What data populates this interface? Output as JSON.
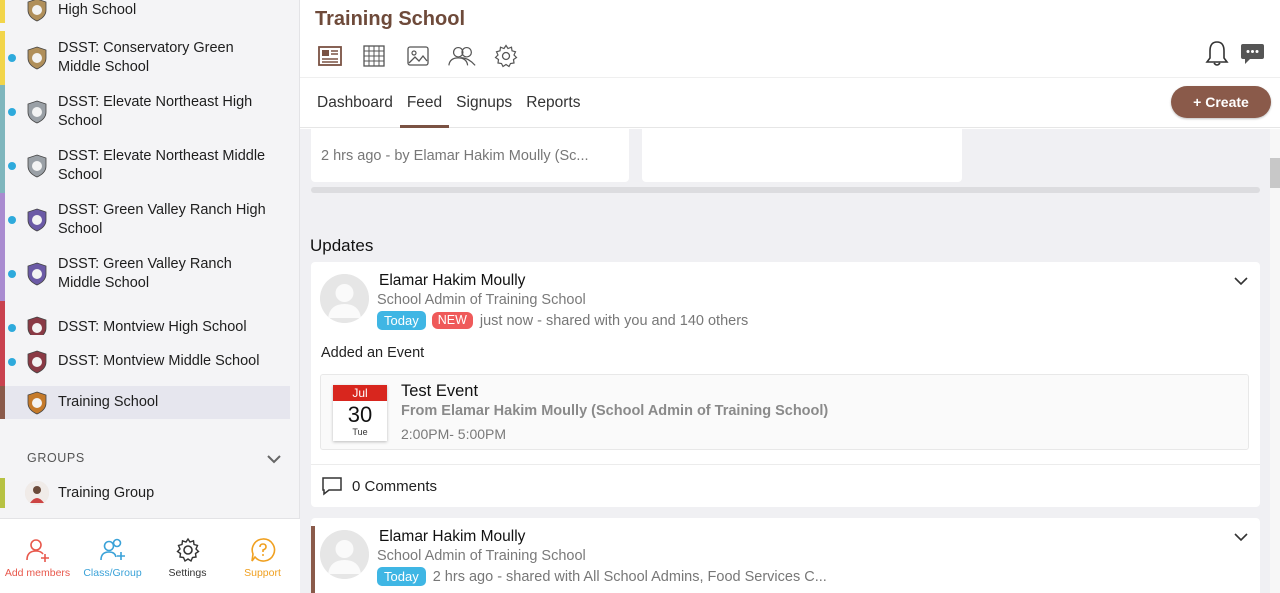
{
  "sidebar": {
    "schools": [
      {
        "name": "High School",
        "bar_color": "#f2d54a",
        "dot": false,
        "logo_color": "#b08f5a"
      },
      {
        "name": "DSST: Conservatory Green Middle School",
        "bar_color": "#f2d54a",
        "dot": true,
        "logo_color": "#b08f5a"
      },
      {
        "name": "DSST: Elevate Northeast High School",
        "bar_color": "#7fb6bd",
        "dot": true,
        "logo_color": "#9aa0a6"
      },
      {
        "name": "DSST: Elevate Northeast Middle School",
        "bar_color": "#7fb6bd",
        "dot": true,
        "logo_color": "#9aa0a6"
      },
      {
        "name": "DSST: Green Valley Ranch High School",
        "bar_color": "#a98bd0",
        "dot": true,
        "logo_color": "#6b5aa6"
      },
      {
        "name": "DSST: Green Valley Ranch Middle School",
        "bar_color": "#a98bd0",
        "dot": true,
        "logo_color": "#6b5aa6"
      },
      {
        "name": "DSST: Montview High School",
        "bar_color": "#c9424f",
        "dot": true,
        "logo_color": "#8a3a45"
      },
      {
        "name": "DSST: Montview Middle School",
        "bar_color": "#c9424f",
        "dot": true,
        "logo_color": "#8a3a45"
      },
      {
        "name": "Training School",
        "bar_color": "#8a5a4a",
        "dot": false,
        "logo_color": "#c57a2a",
        "active": true
      }
    ],
    "groups_label": "GROUPS",
    "group": {
      "name": "Training Group",
      "bar_color": "#b7c243"
    },
    "bottom": [
      {
        "label": "Add members",
        "color": "#e8584c",
        "icon": "add-member-icon"
      },
      {
        "label": "Class/Group",
        "color": "#3aa2d8",
        "icon": "class-group-icon"
      },
      {
        "label": "Settings",
        "color": "#333333",
        "icon": "gear-icon"
      },
      {
        "label": "Support",
        "color": "#f0a020",
        "icon": "support-icon"
      }
    ]
  },
  "header": {
    "title": "Training School",
    "tabs": [
      "Dashboard",
      "Feed",
      "Signups",
      "Reports"
    ],
    "active_tab": "Feed",
    "create_label": "+ Create"
  },
  "feed": {
    "prev_meta": "2 hrs ago - by Elamar Hakim Moully (Sc...",
    "updates_title": "Updates",
    "post1": {
      "author": "Elamar Hakim Moully",
      "role": "School Admin of Training School",
      "badge_today": "Today",
      "badge_new": "NEW",
      "meta": "just now - shared with you and 140 others",
      "action": "Added an Event",
      "event": {
        "month": "Jul",
        "day": "30",
        "dow": "Tue",
        "title": "Test Event",
        "from": "From Elamar Hakim Moully (School Admin of Training School)",
        "time": "2:00PM- 5:00PM"
      },
      "comments": "0 Comments"
    },
    "post2": {
      "author": "Elamar Hakim Moully",
      "role": "School Admin of Training School",
      "badge_today": "Today",
      "meta": "2 hrs ago - shared with All School Admins, Food Services C..."
    }
  },
  "colors": {
    "brand": "#8a5a4a",
    "title": "#6e4a3a",
    "today_badge": "#3fb6e4",
    "new_badge": "#ef5a5a",
    "calendar_red": "#d8261e"
  }
}
